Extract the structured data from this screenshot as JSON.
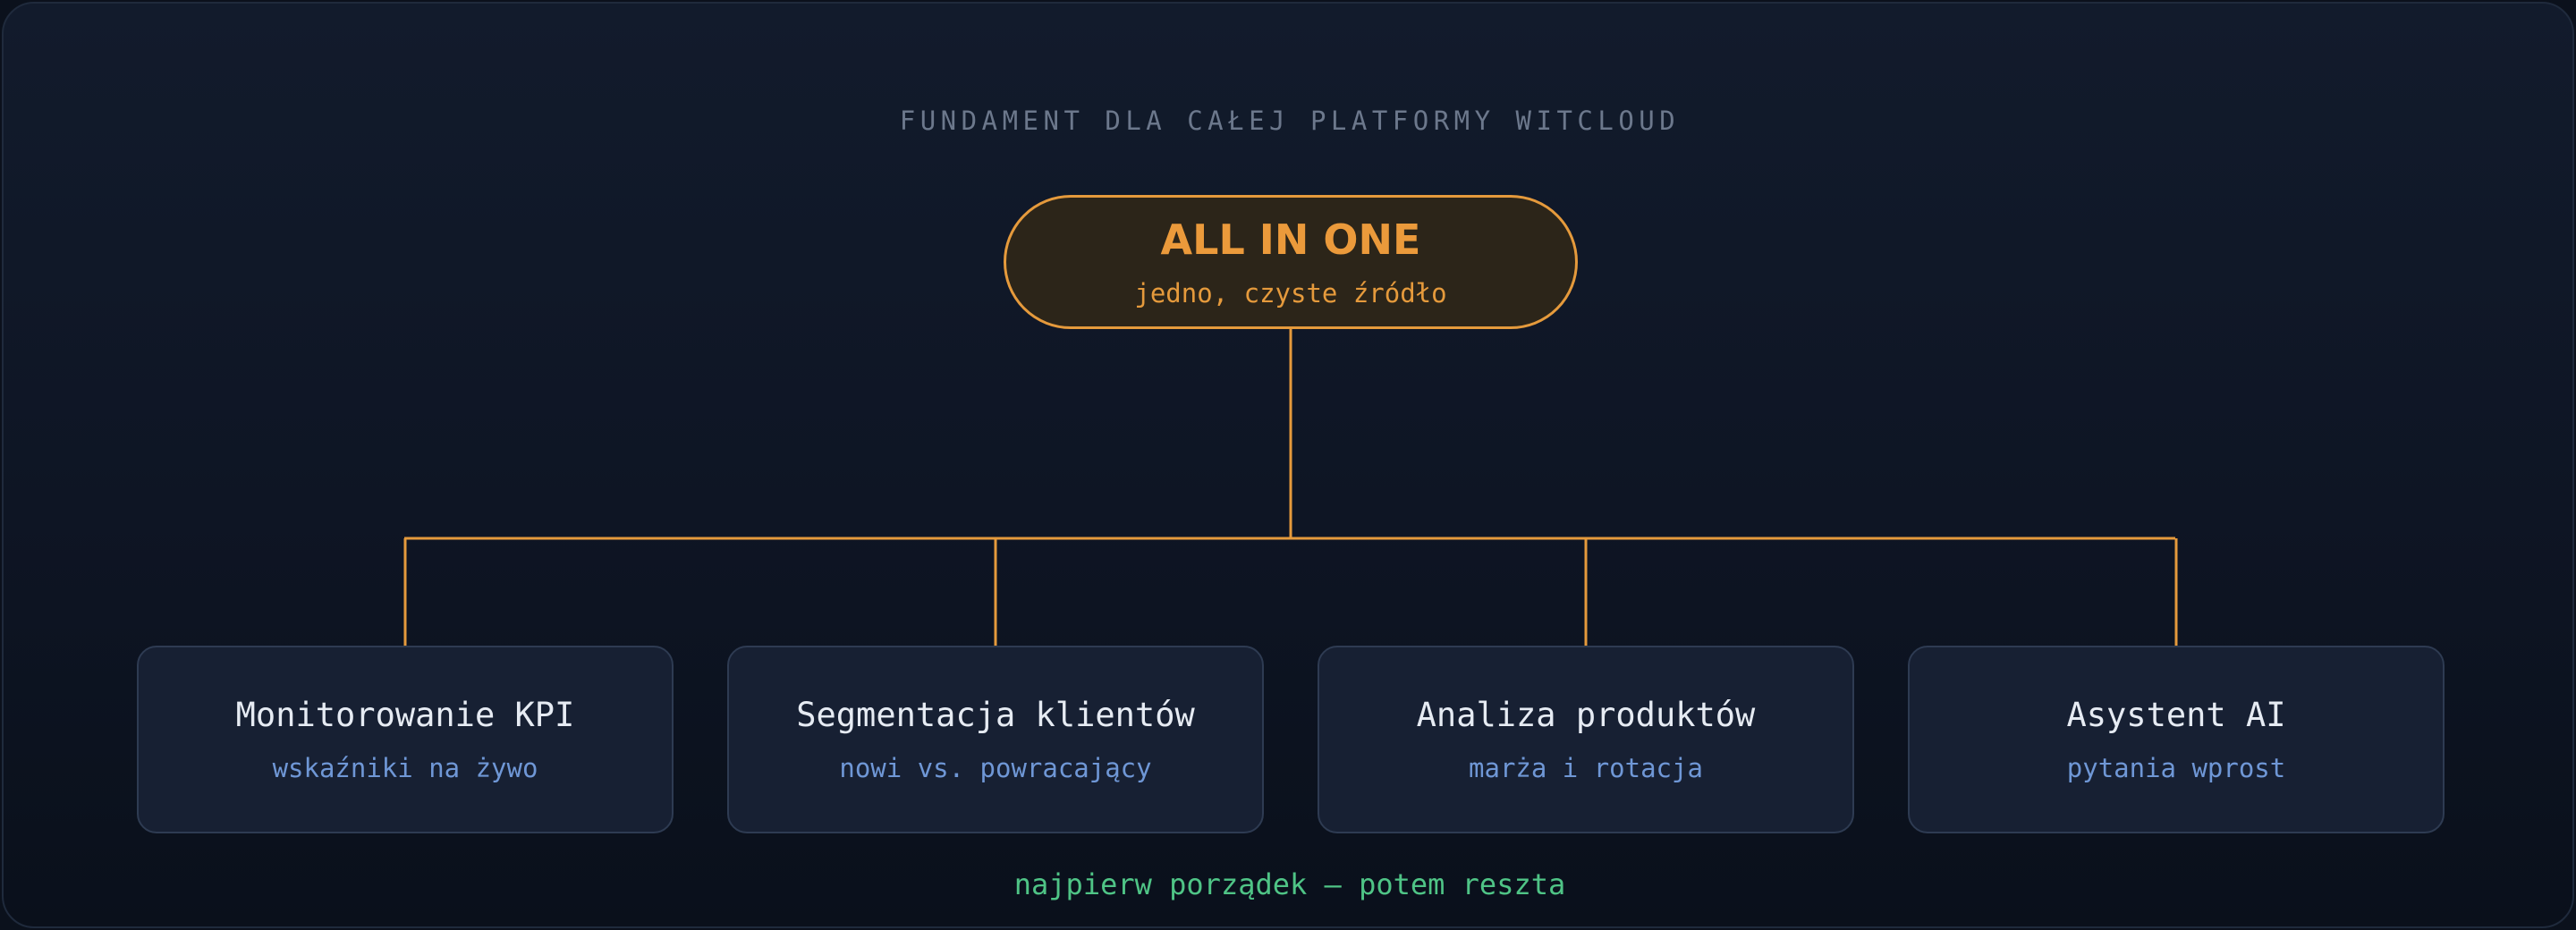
{
  "header": {
    "eyebrow": "FUNDAMENT DLA CAŁEJ PLATFORMY WITCLOUD"
  },
  "root_node": {
    "title": "ALL IN ONE",
    "subtitle": "jedno, czyste źródło"
  },
  "children": [
    {
      "title": "Monitorowanie KPI",
      "subtitle": "wskaźniki na żywo"
    },
    {
      "title": "Segmentacja klientów",
      "subtitle": "nowi vs. powracający"
    },
    {
      "title": "Analiza produktów",
      "subtitle": "marża i rotacja"
    },
    {
      "title": "Asystent AI",
      "subtitle": "pytania wprost"
    }
  ],
  "footer": {
    "tagline": "najpierw porządek — potem reszta"
  },
  "colors": {
    "background": "#0e1524",
    "accent_orange": "#e59a3c",
    "root_fill": "#2c2519",
    "card_fill": "#172033",
    "card_border": "#2e3b52",
    "subtitle_blue": "#6f97d6",
    "footer_green": "#4fc486",
    "muted_text": "#6c788c"
  }
}
